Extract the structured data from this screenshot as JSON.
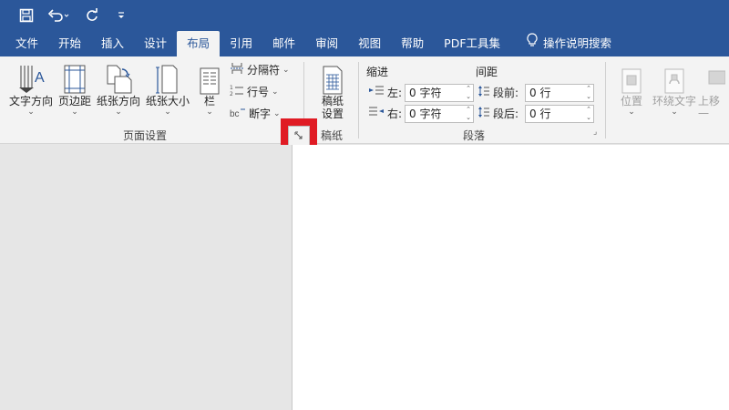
{
  "qat": {
    "icons": [
      "save-icon",
      "undo-icon",
      "redo-icon",
      "customize-icon"
    ]
  },
  "tabs": [
    {
      "label": "文件"
    },
    {
      "label": "开始"
    },
    {
      "label": "插入"
    },
    {
      "label": "设计"
    },
    {
      "label": "布局",
      "active": true
    },
    {
      "label": "引用"
    },
    {
      "label": "邮件"
    },
    {
      "label": "审阅"
    },
    {
      "label": "视图"
    },
    {
      "label": "帮助"
    },
    {
      "label": "PDF工具集"
    }
  ],
  "search_label": "操作说明搜索",
  "page_setup": {
    "text_direction": "文字方向",
    "margins": "页边距",
    "orientation": "纸张方向",
    "size": "纸张大小",
    "columns": "栏",
    "breaks": "分隔符",
    "line_numbers": "行号",
    "hyphenation": "断字",
    "group_label": "页面设置"
  },
  "manuscript": {
    "button_line1": "稿纸",
    "button_line2": "设置",
    "group_label": "稿纸"
  },
  "paragraph": {
    "indent_title": "缩进",
    "spacing_title": "间距",
    "left_label": "左:",
    "right_label": "右:",
    "before_label": "段前:",
    "after_label": "段后:",
    "left_value": "0 字符",
    "right_value": "0 字符",
    "before_value": "0 行",
    "after_value": "0 行",
    "group_label": "段落"
  },
  "arrange": {
    "position": "位置",
    "wrap_text": "环绕文字",
    "bring_forward": "上移一"
  },
  "colors": {
    "title_bar": "#2b579a",
    "ribbon": "#f3f3f3",
    "highlight": "#e01b24"
  }
}
